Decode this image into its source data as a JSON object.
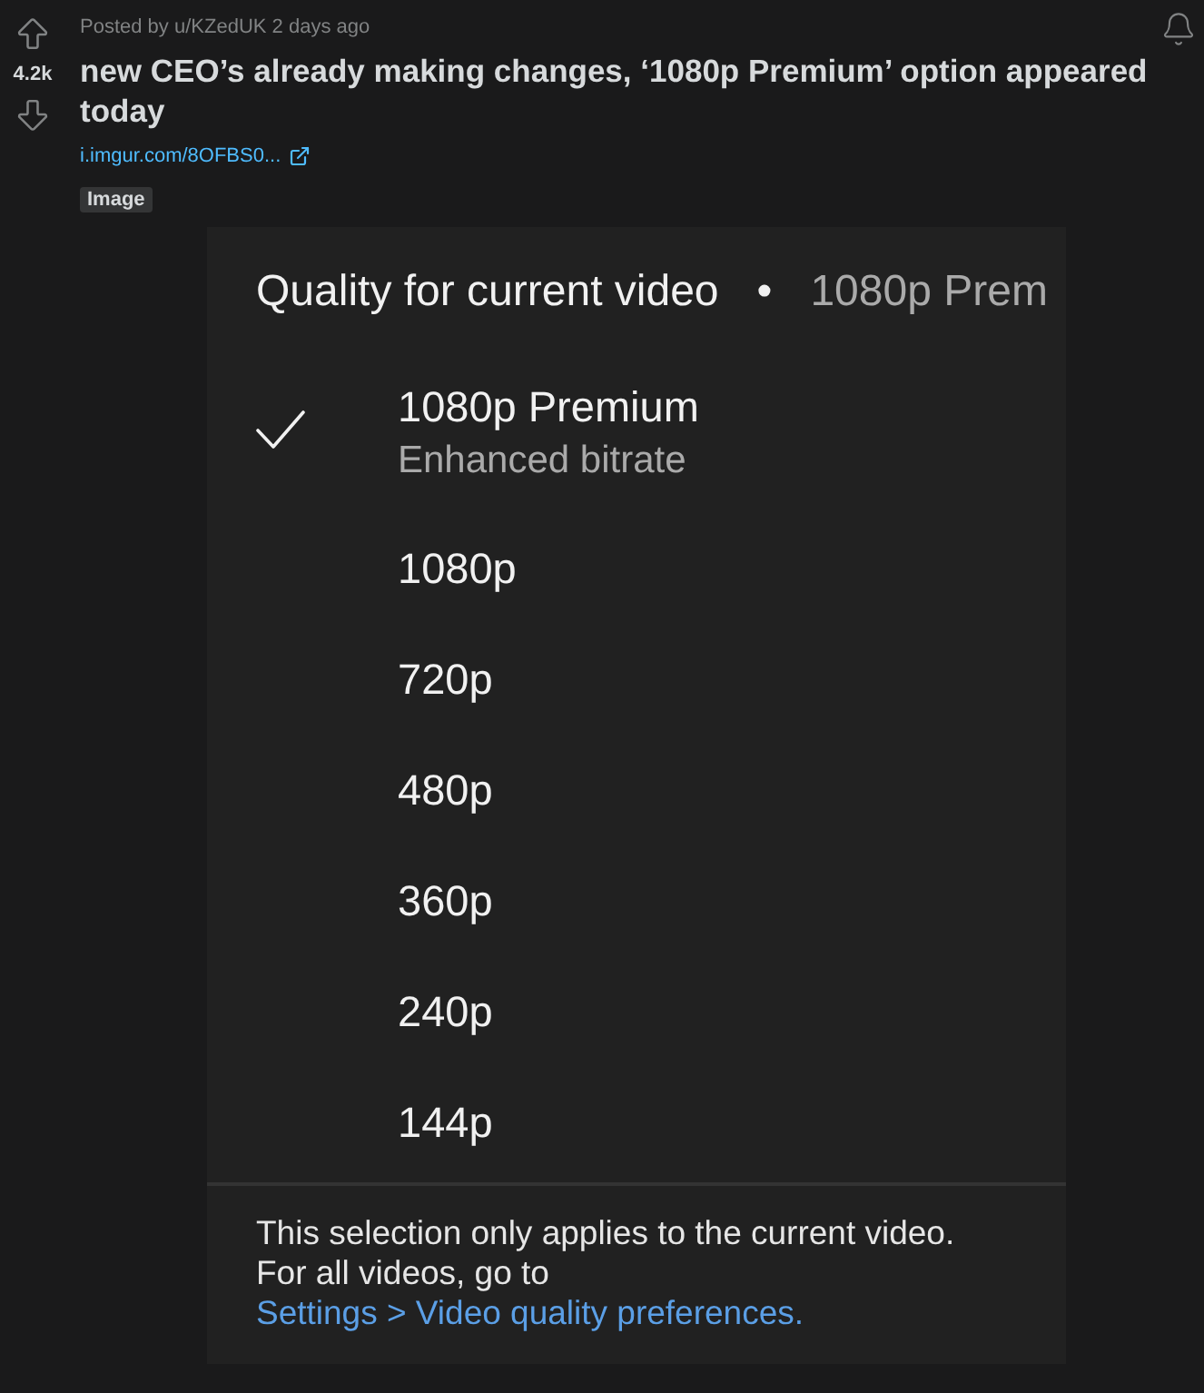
{
  "post": {
    "score": "4.2k",
    "meta": "Posted by u/KZedUK 2 days ago",
    "title": "new CEO’s already making changes, ‘1080p Premium’ option appeared today",
    "link": "i.imgur.com/8OFBS0...",
    "tag": "Image"
  },
  "quality_menu": {
    "title": "Quality for current video",
    "separator": "•",
    "current": "1080p Prem",
    "options": [
      {
        "label": "1080p Premium",
        "sublabel": "Enhanced bitrate",
        "selected": true
      },
      {
        "label": "1080p",
        "selected": false
      },
      {
        "label": "720p",
        "selected": false
      },
      {
        "label": "480p",
        "selected": false
      },
      {
        "label": "360p",
        "selected": false
      },
      {
        "label": "240p",
        "selected": false
      },
      {
        "label": "144p",
        "selected": false
      }
    ],
    "footer": {
      "text": "This selection only applies to the current video. For all videos, go to ",
      "link": "Settings > Video quality preferences."
    }
  }
}
